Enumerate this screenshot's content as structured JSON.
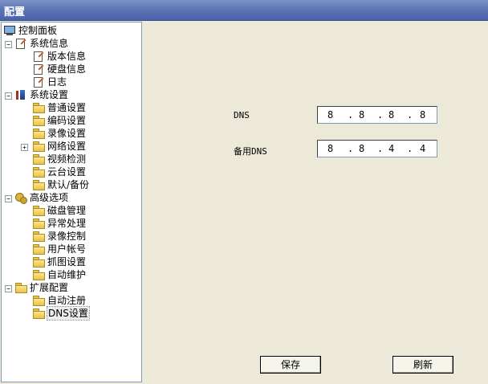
{
  "window": {
    "title": "配置"
  },
  "tree": {
    "root": "控制面板",
    "system_info": {
      "label": "系统信息",
      "items": [
        "版本信息",
        "硬盘信息",
        "日志"
      ]
    },
    "system_settings": {
      "label": "系统设置",
      "items": [
        "普通设置",
        "编码设置",
        "录像设置",
        "网络设置",
        "视频检测",
        "云台设置",
        "默认/备份"
      ]
    },
    "advanced": {
      "label": "高级选项",
      "items": [
        "磁盘管理",
        "异常处理",
        "录像控制",
        "用户帐号",
        "抓图设置",
        "自动维护"
      ]
    },
    "extended": {
      "label": "扩展配置",
      "items": [
        "自动注册",
        "DNS设置"
      ]
    },
    "selected": "DNS设置"
  },
  "dns": {
    "primary_label": "DNS",
    "primary": [
      "8",
      "8",
      "8",
      "8"
    ],
    "secondary_label": "备用DNS",
    "secondary": [
      "8",
      "8",
      "4",
      "4"
    ]
  },
  "buttons": {
    "save": "保存",
    "refresh": "刷新"
  }
}
